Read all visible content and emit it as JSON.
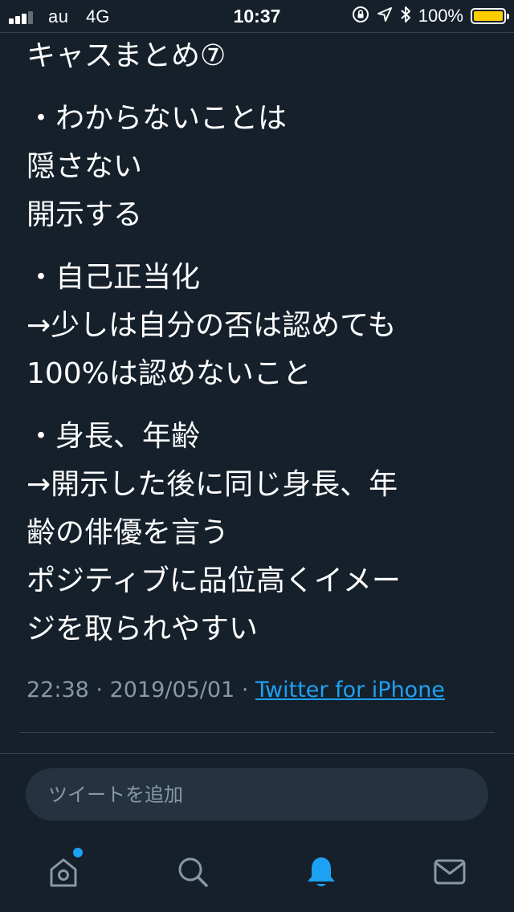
{
  "status_bar": {
    "carrier": "au",
    "network": "4G",
    "time": "10:37",
    "battery_percent": "100%",
    "battery_color": "#ffcc00"
  },
  "tweet": {
    "paragraphs": [
      [
        "キャスまとめ⑦"
      ],
      [
        "・わからないことは",
        "隠さない",
        "開示する"
      ],
      [
        "・自己正当化",
        "→少しは自分の否は認めても",
        "100%は認めないこと"
      ],
      [
        "・身長、年齢",
        "→開示した後に同じ身長、年",
        "齢の俳優を言う",
        "ポジティブに品位高くイメー",
        "ジを取られやすい"
      ]
    ],
    "time": "22:38",
    "date": "2019/05/01",
    "separator": "·",
    "source": "Twitter for iPhone"
  },
  "composer": {
    "placeholder": "ツイートを追加"
  },
  "tab_bar": {
    "tabs": [
      {
        "name": "home",
        "icon": "home-icon",
        "active": false,
        "has_dot": true
      },
      {
        "name": "search",
        "icon": "search-icon",
        "active": false,
        "has_dot": false
      },
      {
        "name": "notifications",
        "icon": "bell-icon",
        "active": true,
        "has_dot": false
      },
      {
        "name": "messages",
        "icon": "envelope-icon",
        "active": false,
        "has_dot": false
      }
    ],
    "active_color": "#1da1f2",
    "inactive_color": "#8899a6"
  }
}
